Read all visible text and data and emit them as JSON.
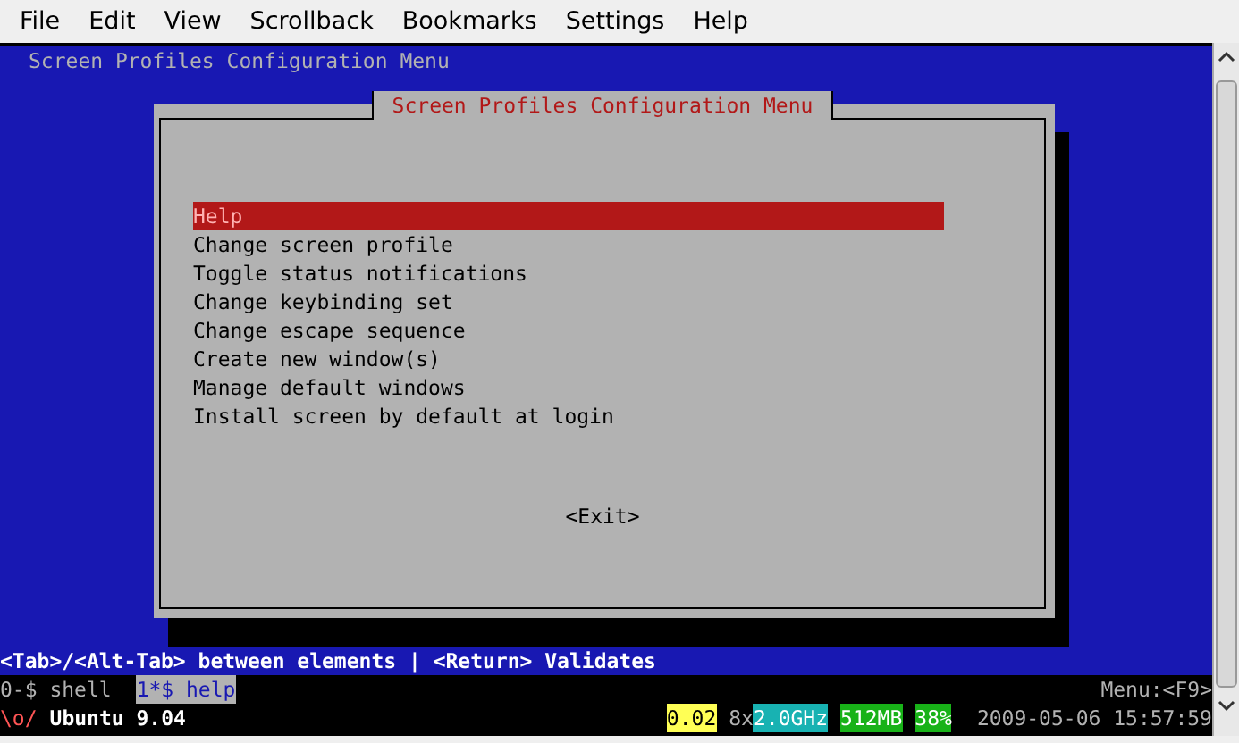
{
  "menubar": {
    "items": [
      "File",
      "Edit",
      "View",
      "Scrollback",
      "Bookmarks",
      "Settings",
      "Help"
    ]
  },
  "terminal": {
    "title": "Screen Profiles Configuration Menu",
    "dialog": {
      "title": "Screen Profiles Configuration Menu",
      "items": [
        {
          "label": "Help",
          "selected": true
        },
        {
          "label": "Change screen profile",
          "selected": false
        },
        {
          "label": "Toggle status notifications",
          "selected": false
        },
        {
          "label": "Change keybinding set",
          "selected": false
        },
        {
          "label": "Change escape sequence",
          "selected": false
        },
        {
          "label": "Create new window(s)",
          "selected": false
        },
        {
          "label": "Manage default windows",
          "selected": false
        },
        {
          "label": "Install screen by default at login",
          "selected": false
        }
      ],
      "button": "<Exit>"
    },
    "hint": "<Tab>/<Alt-Tab> between elements | <Return> Validates",
    "windows": [
      {
        "label": "0-$ shell",
        "selected": false
      },
      {
        "label": "1*$ help",
        "selected": true
      }
    ],
    "menu_hint": "Menu:<F9>",
    "status": {
      "logo": "\\o/",
      "distro": "Ubuntu 9.04",
      "segments": [
        {
          "text": "0.02",
          "kind": "badge",
          "color": "#ffff55"
        },
        {
          "text": "8x",
          "kind": "plain"
        },
        {
          "text": "2.0GHz",
          "kind": "badge",
          "color": "#18b2b2"
        },
        {
          "text": "512MB",
          "kind": "badge",
          "color": "#18b218"
        },
        {
          "text": "38%",
          "kind": "badge",
          "color": "#18b218"
        },
        {
          "text": "2009-05-06 15:57:59",
          "kind": "plain"
        }
      ]
    }
  }
}
